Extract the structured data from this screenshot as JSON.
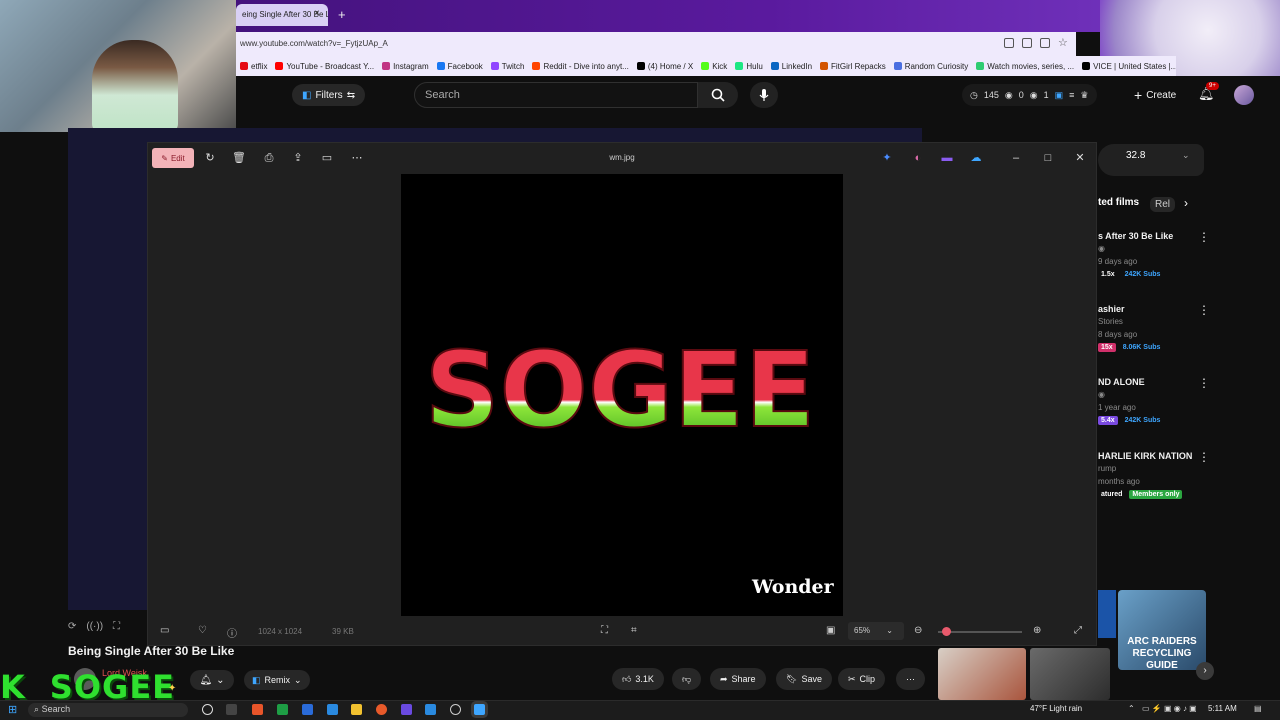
{
  "browser": {
    "tab_title": "eing Single After 30 Be L",
    "tab_close": "×",
    "new_tab": "+",
    "url": "www.youtube.com/watch?v=_FytjzUAp_A",
    "bookmarks": [
      {
        "label": "etflix",
        "color": "#e50914"
      },
      {
        "label": "YouTube - Broadcast Y...",
        "color": "#ff0000"
      },
      {
        "label": "Instagram",
        "color": "#c13584"
      },
      {
        "label": "Facebook",
        "color": "#1877f2"
      },
      {
        "label": "Twitch",
        "color": "#9146ff"
      },
      {
        "label": "Reddit - Dive into anyt...",
        "color": "#ff4500"
      },
      {
        "label": "(4) Home / X",
        "color": "#000000"
      },
      {
        "label": "Kick",
        "color": "#53fc18"
      },
      {
        "label": "Hulu",
        "color": "#1ce783"
      },
      {
        "label": "LinkedIn",
        "color": "#0a66c2"
      },
      {
        "label": "FitGirl Repacks",
        "color": "#d35400"
      },
      {
        "label": "Random Curiosity",
        "color": "#4a6ee0"
      },
      {
        "label": "Watch movies, series, ...",
        "color": "#2ecc71"
      },
      {
        "label": "VICE | United States |...",
        "color": "#000000"
      }
    ]
  },
  "youtube": {
    "filters_label": "Filters",
    "search_placeholder": "Search",
    "stats": {
      "views": "145",
      "comments": "0",
      "other": "1"
    },
    "create_label": "Create",
    "notif_badge": "9+"
  },
  "viewer": {
    "edit_label": "Edit",
    "filename": "wm.jpg",
    "image_text": "SOGEE",
    "watermark": "Wonder",
    "dimensions": "1024 x 1024",
    "filesize": "39 KB",
    "zoom": "65%",
    "zoom_level": 0.1
  },
  "sidebar": {
    "top_value": "32.8",
    "chip_related": "ted films",
    "chip_re": "Rel",
    "recs": [
      {
        "title": "s After 30 Be Like",
        "meta1": "",
        "meta2": "9 days ago",
        "tag1": "1.5x",
        "tag1_color": "#ffffff",
        "tag2": "242K Subs",
        "tag2_color": "#3ea6ff"
      },
      {
        "title": "ashier",
        "meta1": "Stories",
        "meta2": "8 days ago",
        "tag1": "15x",
        "tag1_color": "#ff4e8a",
        "tag2": "8.06K Subs",
        "tag2_color": "#3ea6ff"
      },
      {
        "title": "ND ALONE",
        "meta1": "",
        "meta2": "1 year ago",
        "tag1": "5.4x",
        "tag1_color": "#9a6bff",
        "tag2": "242K Subs",
        "tag2_color": "#3ea6ff"
      },
      {
        "title": "HARLIE KIRK NATION",
        "meta1": "rump",
        "meta2": "months ago",
        "tag1": "atured",
        "tag1_color": "#ffffff",
        "tag2": "Members only",
        "tag2_color": "#2ba640"
      }
    ],
    "arc_text": "ARC RAIDERS RECYCLING GUIDE"
  },
  "video": {
    "title": "Being Single After 30 Be Like",
    "channel": "Lord Weisk",
    "overlay_text": "SOGEE",
    "overlay_k": "K",
    "remix_label": "Remix",
    "likes": "3.1K",
    "share_label": "Share",
    "save_label": "Save",
    "clip_label": "Clip"
  },
  "taskbar": {
    "search_label": "Search",
    "weather": "47°F  Light rain",
    "time": "5:11 AM"
  }
}
